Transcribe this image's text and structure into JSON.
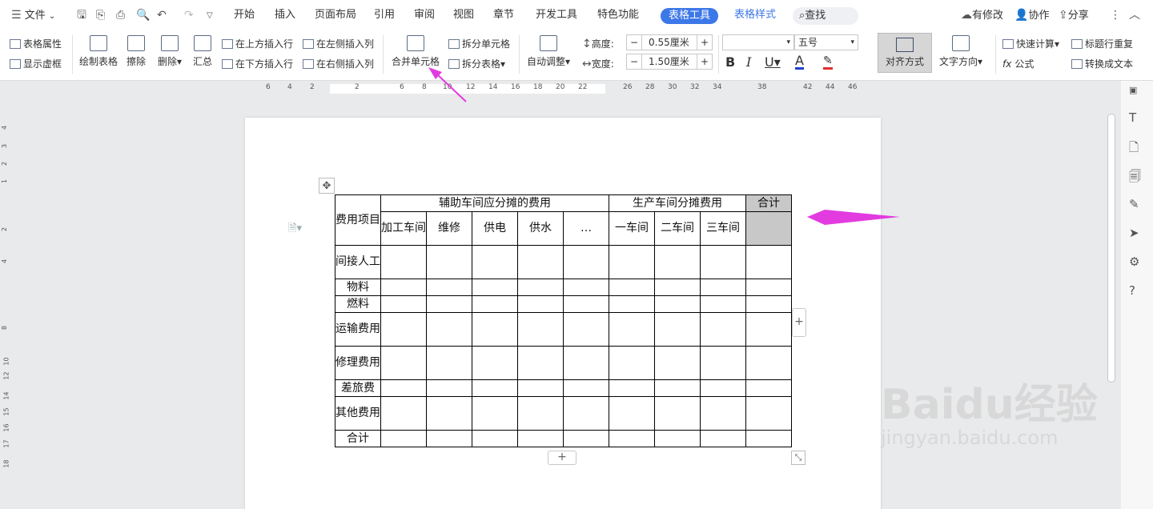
{
  "menubar": {
    "file": "文件",
    "tabs": [
      "开始",
      "插入",
      "页面布局",
      "引用",
      "审阅",
      "视图",
      "章节",
      "开发工具",
      "特色功能"
    ],
    "active_tab": "表格工具",
    "tab_style": "表格样式",
    "search": "查找",
    "has_changes": "有修改",
    "collab": "协作",
    "share": "分享"
  },
  "ribbon": {
    "table_props": "表格属性",
    "show_gridlines": "显示虚框",
    "draw_table": "绘制表格",
    "erase": "擦除",
    "delete": "删除",
    "summary": "汇总",
    "insert_above": "在上方插入行",
    "insert_below": "在下方插入行",
    "insert_left": "在左侧插入列",
    "insert_right": "在右侧插入列",
    "merge_cells": "合并单元格",
    "split_cells": "拆分单元格",
    "split_table": "拆分表格",
    "auto_fit": "自动调整",
    "height_label": "高度:",
    "height_value": "0.55厘米",
    "width_label": "宽度:",
    "width_value": "1.50厘米",
    "font_name": "",
    "font_size": "五号",
    "align": "对齐方式",
    "text_direction": "文字方向",
    "quick_calc": "快速计算",
    "repeat_header": "标题行重复",
    "formula": "公式",
    "to_text": "转换成文本"
  },
  "ruler": {
    "ticks": [
      "6",
      "4",
      "2",
      "2",
      "6",
      "8",
      "10",
      "12",
      "14",
      "16",
      "18",
      "20",
      "22",
      "26",
      "28",
      "30",
      "32",
      "34",
      "38",
      "42",
      "44",
      "46"
    ]
  },
  "vruler": {
    "ticks": [
      "4",
      "3",
      "2",
      "1",
      "2",
      "4",
      "8",
      "10",
      "12",
      "14",
      "15",
      "16",
      "17",
      "18"
    ]
  },
  "table": {
    "h1": "费用项目",
    "group_aux": "辅助车间应分摊的费用",
    "group_prod": "生产车间分摊费用",
    "total_header": "合计",
    "sub": [
      "加工车间",
      "维修",
      "供电",
      "供水",
      "…",
      "一车间",
      "二车间",
      "三车间"
    ],
    "rows": [
      "间接人工",
      "物料",
      "燃料",
      "运输费用",
      "修理费用",
      "差旅费",
      "其他费用",
      "合计"
    ]
  },
  "watermark": {
    "brand": "Baidu经验",
    "url": "jingyan.baidu.com"
  },
  "colors": {
    "active_tab": "#3d78e8",
    "arrow": "#e23be0",
    "shade": "#c8c8c8"
  }
}
